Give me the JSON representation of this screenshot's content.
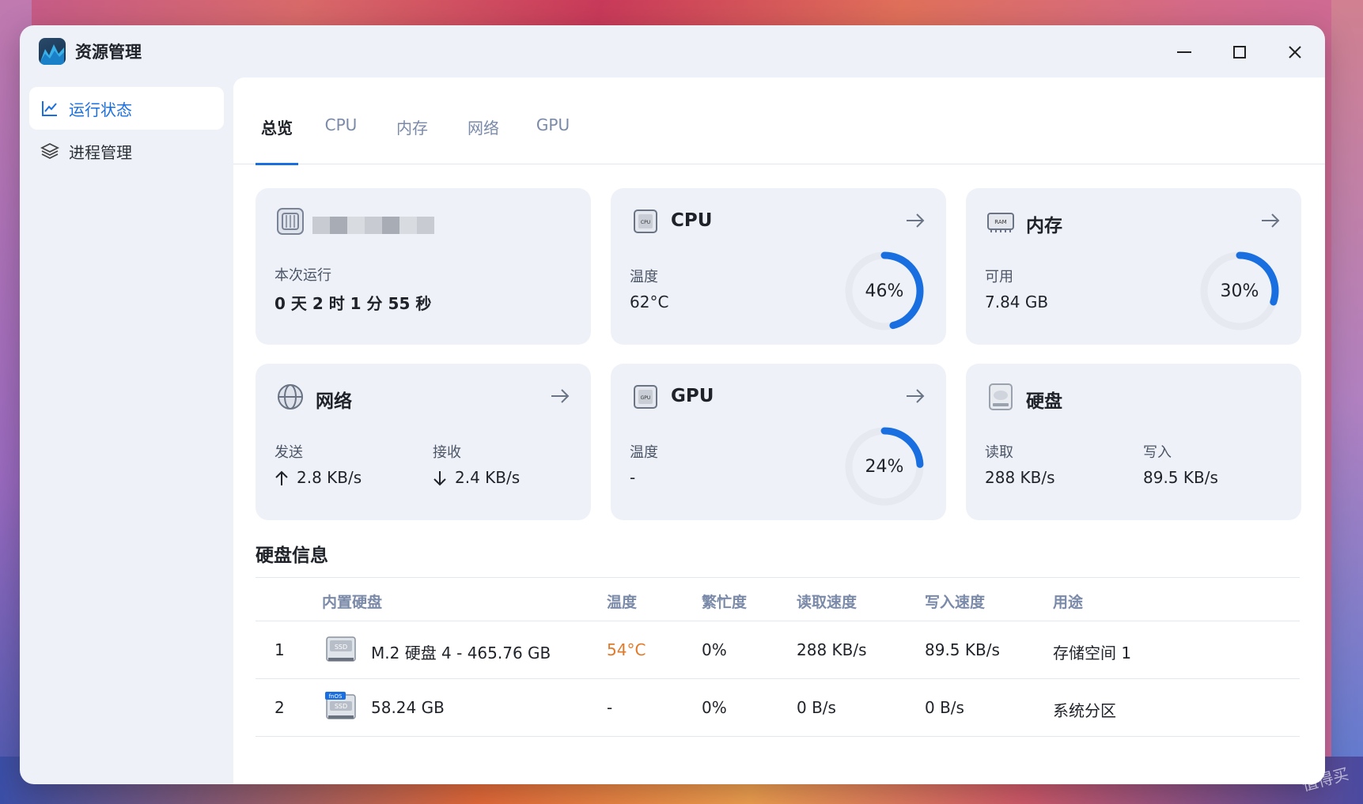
{
  "app": {
    "title": "资源管理"
  },
  "sidebar": {
    "items": [
      {
        "label": "运行状态",
        "icon": "chart-line-icon",
        "active": true
      },
      {
        "label": "进程管理",
        "icon": "layers-icon",
        "active": false
      }
    ]
  },
  "tabs": [
    {
      "label": "总览",
      "active": true
    },
    {
      "label": "CPU",
      "active": false
    },
    {
      "label": "内存",
      "active": false
    },
    {
      "label": "网络",
      "active": false
    },
    {
      "label": "GPU",
      "active": false
    }
  ],
  "cards": {
    "system": {
      "uptime_label": "本次运行",
      "uptime_value": "0 天 2 时 1 分 55 秒"
    },
    "cpu": {
      "title": "CPU",
      "metric_label": "温度",
      "metric_value": "62°C",
      "usage_percent": 46,
      "usage_text": "46%"
    },
    "memory": {
      "title": "内存",
      "metric_label": "可用",
      "metric_value": "7.84 GB",
      "usage_percent": 30,
      "usage_text": "30%"
    },
    "network": {
      "title": "网络",
      "send_label": "发送",
      "send_value": "2.8 KB/s",
      "recv_label": "接收",
      "recv_value": "2.4 KB/s"
    },
    "gpu": {
      "title": "GPU",
      "metric_label": "温度",
      "metric_value": "-",
      "usage_percent": 24,
      "usage_text": "24%"
    },
    "disk": {
      "title": "硬盘",
      "read_label": "读取",
      "read_value": "288 KB/s",
      "write_label": "写入",
      "write_value": "89.5 KB/s"
    }
  },
  "disk_info": {
    "title": "硬盘信息",
    "columns": [
      "内置硬盘",
      "温度",
      "繁忙度",
      "读取速度",
      "写入速度",
      "用途"
    ],
    "rows": [
      {
        "index": "1",
        "name": "M.2 硬盘 4 - 465.76 GB",
        "temp": "54°C",
        "busy": "0%",
        "read": "288 KB/s",
        "write": "89.5 KB/s",
        "usage": "存储空间 1",
        "badge": "SSD"
      },
      {
        "index": "2",
        "name": "58.24 GB",
        "temp": "-",
        "busy": "0%",
        "read": "0 B/s",
        "write": "0 B/s",
        "usage": "系统分区",
        "badge": "SSD",
        "os_badge": "fnOS"
      }
    ]
  },
  "colors": {
    "accent": "#1a6fe0",
    "warm": "#e07a2a",
    "ring_track": "#e6e9ef"
  },
  "watermark": "值得买"
}
